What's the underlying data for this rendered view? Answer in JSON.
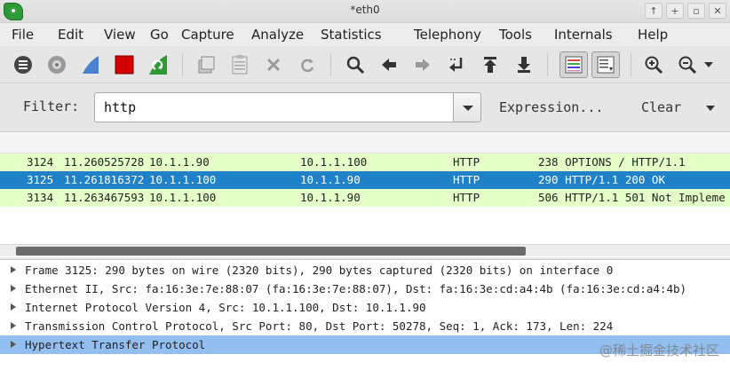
{
  "window": {
    "title": "*eth0",
    "controls": [
      "up-arrow-icon",
      "restore-icon",
      "minimize-icon",
      "close-icon"
    ]
  },
  "menu": {
    "items": [
      "File",
      "Edit",
      "View",
      "Go",
      "Capture",
      "Analyze",
      "Statistics",
      "Telephony",
      "Tools",
      "Internals",
      "Help"
    ]
  },
  "toolbar": {
    "icons": [
      "interfaces-icon",
      "capture-options-icon",
      "start-capture-icon",
      "stop-capture-icon",
      "restart-capture-icon",
      "open-file-icon",
      "save-file-icon",
      "close-file-icon",
      "reload-icon",
      "find-packet-icon",
      "go-back-icon",
      "go-forward-icon",
      "go-to-packet-icon",
      "go-first-icon",
      "go-last-icon",
      "colorize-icon",
      "auto-scroll-icon",
      "zoom-in-icon",
      "zoom-out-icon"
    ],
    "colors": {
      "stop": "#d40000",
      "fin_blue": "#4a7fd1",
      "restart_green": "#2e9a35"
    }
  },
  "filter": {
    "label": "Filter:",
    "value": "http",
    "expression_label": "Expression...",
    "clear_label": "Clear"
  },
  "packets": [
    {
      "no": "3124",
      "time": "11.260525728",
      "source": "10.1.1.90",
      "destination": "10.1.1.100",
      "protocol": "HTTP",
      "info": "238 OPTIONS / HTTP/1.1",
      "bg": "#e4ffc7",
      "fg": "#222222"
    },
    {
      "no": "3125",
      "time": "11.261816372",
      "source": "10.1.1.100",
      "destination": "10.1.1.90",
      "protocol": "HTTP",
      "info": "290 HTTP/1.1 200 OK",
      "bg": "#1f82c8",
      "fg": "#ffffff"
    },
    {
      "no": "3134",
      "time": "11.263467593",
      "source": "10.1.1.100",
      "destination": "10.1.1.90",
      "protocol": "HTTP",
      "info": "506 HTTP/1.1 501 Not Impleme",
      "bg": "#e4ffc7",
      "fg": "#222222"
    }
  ],
  "details": [
    {
      "text": "Frame 3125: 290 bytes on wire (2320 bits), 290 bytes captured (2320 bits) on interface 0",
      "selected": false
    },
    {
      "text": "Ethernet II, Src: fa:16:3e:7e:88:07 (fa:16:3e:7e:88:07), Dst: fa:16:3e:cd:a4:4b (fa:16:3e:cd:a4:4b)",
      "selected": false
    },
    {
      "text": "Internet Protocol Version 4, Src: 10.1.1.100, Dst: 10.1.1.90",
      "selected": false
    },
    {
      "text": "Transmission Control Protocol, Src Port: 80, Dst Port: 50278, Seq: 1, Ack: 173, Len: 224",
      "selected": false
    },
    {
      "text": "Hypertext Transfer Protocol",
      "selected": true
    }
  ],
  "watermark": "@稀土掘金技术社区"
}
